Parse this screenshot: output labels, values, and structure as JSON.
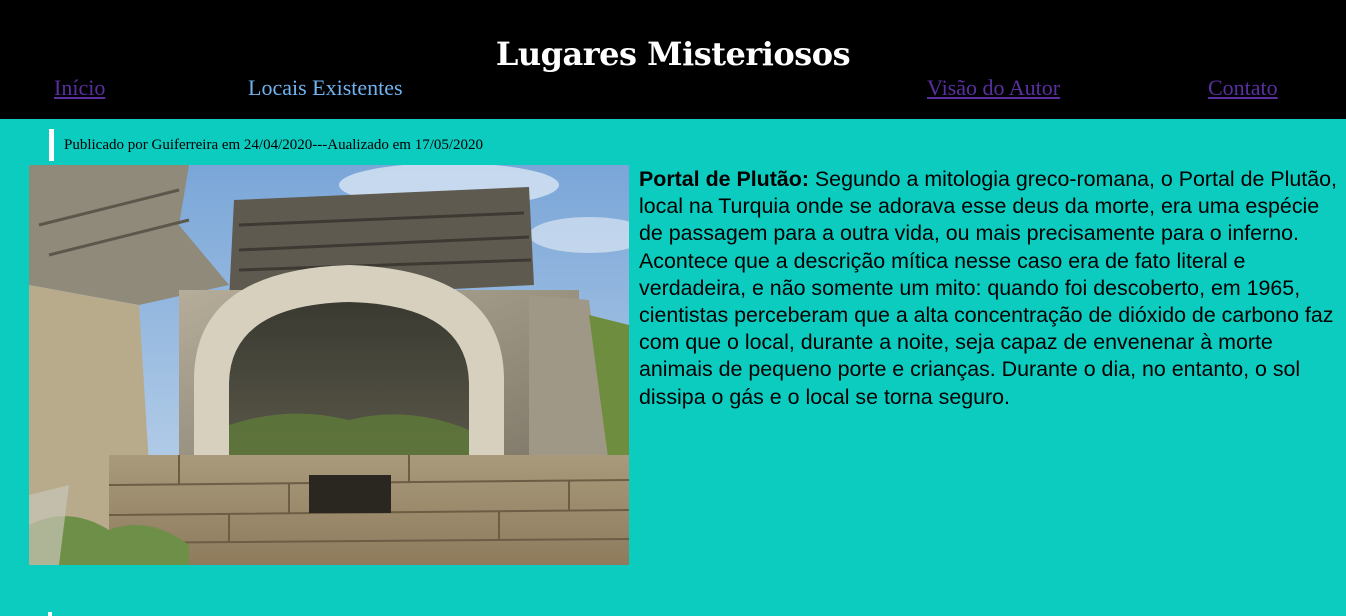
{
  "header": {
    "title": "Lugares Misteriosos",
    "nav": [
      {
        "label": "Início",
        "active": false
      },
      {
        "label": "Locais Existentes",
        "active": true
      },
      {
        "label": "Visão do Autor",
        "active": false
      },
      {
        "label": "Contato",
        "active": false
      }
    ]
  },
  "post": {
    "meta": "Publicado por Guiferreira em 24/04/2020---Aualizado em 17/05/2020",
    "image_subject": "portal-de-plutao-ruins-photo",
    "heading": "Portal de Plutão:",
    "body": " Segundo a mitologia greco-romana, o Portal de Plutão, local na Turquia onde se adorava esse deus da morte, era uma espécie de passagem para a outra vida, ou mais precisamente para o inferno. Acontece que a descrição mítica nesse caso era de fato literal e verdadeira, e não somente um mito: quando foi descoberto, em 1965, cientistas perceberam que a alta concentração de dióxido de carbono faz com que o local, durante a noite, seja capaz de envenenar à morte animais de pequeno porte e crianças. Durante o dia, no entanto, o sol dissipa o gás e o local se torna seguro."
  },
  "colors": {
    "background": "#0ccbbf",
    "header": "#000000",
    "nav_link": "#5a2fa0",
    "nav_active": "#6fb4f0"
  }
}
